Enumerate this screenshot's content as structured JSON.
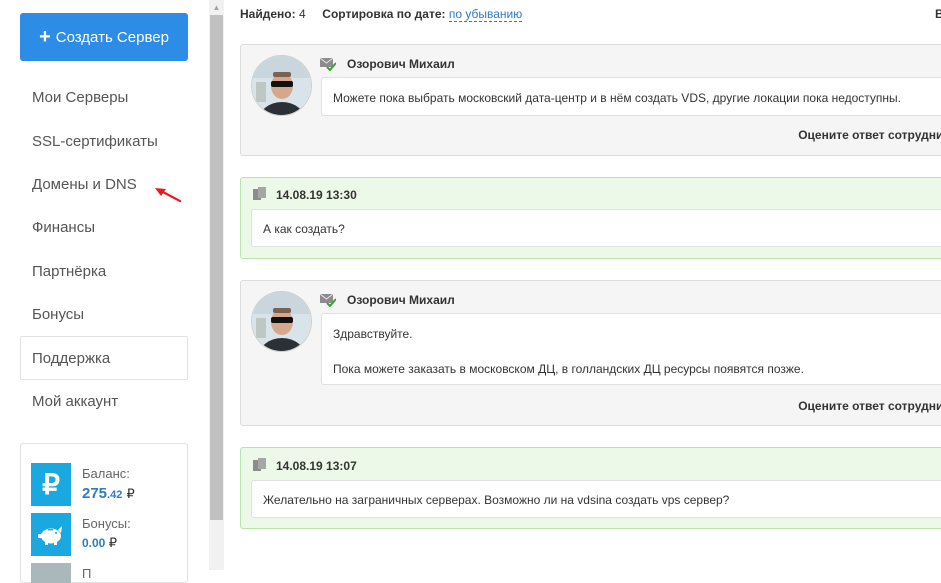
{
  "sidebar": {
    "create_button": "Создать Сервер",
    "nav": [
      {
        "label": "Мои Серверы",
        "active": false
      },
      {
        "label": "SSL-сертификаты",
        "active": false
      },
      {
        "label": "Домены и DNS",
        "active": false
      },
      {
        "label": "Финансы",
        "active": false
      },
      {
        "label": "Партнёрка",
        "active": false
      },
      {
        "label": "Бонусы",
        "active": false
      },
      {
        "label": "Поддержка",
        "active": true
      },
      {
        "label": "Мой аккаунт",
        "active": false
      }
    ],
    "balance": {
      "label": "Баланс:",
      "whole": "275",
      "cents": ".42",
      "currency": "₽",
      "icon": "ruble-icon"
    },
    "bonus": {
      "label": "Бонусы:",
      "value": "0.00",
      "currency": "₽",
      "icon": "piggy-bank-icon"
    },
    "partial_label": "П"
  },
  "toolbar": {
    "found_label": "Найдено:",
    "found_count": "4",
    "sort_label": "Сортировка по дате:",
    "sort_value": "по убыванию",
    "right_cut": "В"
  },
  "messages": [
    {
      "type": "staff",
      "author": "Озорович Михаил",
      "paragraphs": [
        "Можете пока выбрать московский дата-центр и в нём создать VDS, другие локации пока недоступны."
      ],
      "rate_label": "Оцените ответ сотрудника:"
    },
    {
      "type": "client",
      "date": "14.08.19 13:30",
      "text": "А как создать?"
    },
    {
      "type": "staff",
      "author": "Озорович Михаил",
      "paragraphs": [
        "Здравствуйте.",
        "Пока можете заказать в московском ДЦ, в голландских ДЦ ресурсы появятся позже."
      ],
      "rate_label": "Оцените ответ сотрудника:"
    },
    {
      "type": "client",
      "date": "14.08.19 13:07",
      "text": "Желательно на заграничных серверах. Возможно ли на vdsina создать vps сервер?"
    }
  ],
  "colors": {
    "primary": "#2d8ce6",
    "link": "#2d7bc4",
    "client_bg": "#edf9e8",
    "client_border": "#b9e3aa",
    "staff_bg": "#f5f5f5",
    "balance_icon": "#1aa8e0",
    "annotation_arrow": "#e02020"
  }
}
